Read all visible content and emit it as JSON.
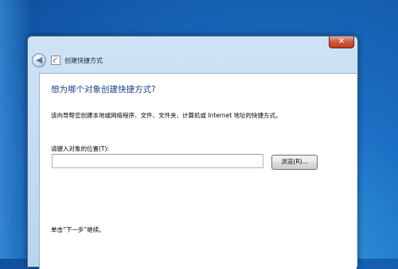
{
  "window": {
    "title": "创建快捷方式",
    "close_glyph": "✕"
  },
  "main": {
    "heading": "想为哪个对象创建快捷方式?",
    "description": "该向导帮您创建本地或网络程序、文件、文件夹、计算机或 Internet 地址的快捷方式。",
    "field_label": "请键入对象的位置(T):",
    "location_value": "",
    "browse_label": "浏览(R)...",
    "hint": "单击“下一步”继续。"
  },
  "icons": {
    "back": "back-arrow-icon",
    "app": "shortcut-icon"
  }
}
